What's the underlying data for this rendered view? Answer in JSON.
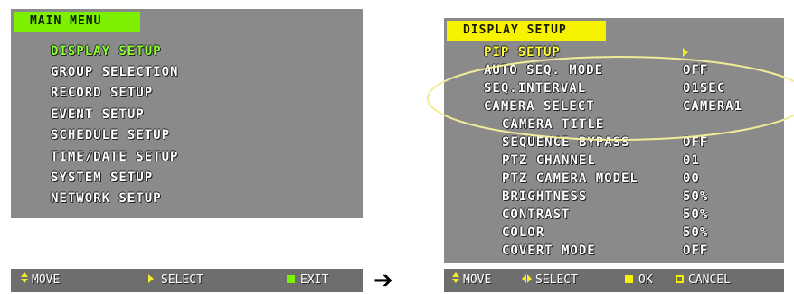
{
  "main_menu": {
    "title": "MAIN MENU",
    "items": [
      "DISPLAY SETUP",
      "GROUP SELECTION",
      "RECORD SETUP",
      "EVENT SETUP",
      "SCHEDULE SETUP",
      "TIME/DATE SETUP",
      "SYSTEM SETUP",
      "NETWORK SETUP"
    ],
    "footer": {
      "move": "MOVE",
      "select": "SELECT",
      "exit": "EXIT"
    }
  },
  "arrow": "➔",
  "display_setup": {
    "title": "DISPLAY SETUP",
    "rows": [
      {
        "label": "PIP SETUP",
        "value": ""
      },
      {
        "label": "AUTO SEQ. MODE",
        "value": "OFF"
      },
      {
        "label": "SEQ.INTERVAL",
        "value": "01SEC"
      },
      {
        "label": "CAMERA SELECT",
        "value": "CAMERA1"
      },
      {
        "label": "CAMERA TITLE",
        "value": ""
      },
      {
        "label": "SEQUENCE BYPASS",
        "value": "OFF"
      },
      {
        "label": "PTZ CHANNEL",
        "value": "01"
      },
      {
        "label": "PTZ CAMERA MODEL",
        "value": "00"
      },
      {
        "label": "BRIGHTNESS",
        "value": "50%"
      },
      {
        "label": "CONTRAST",
        "value": "50%"
      },
      {
        "label": "COLOR",
        "value": "50%"
      },
      {
        "label": "COVERT MODE",
        "value": "OFF"
      }
    ],
    "footer": {
      "move": "MOVE",
      "select": "SELECT",
      "ok": "OK",
      "cancel": "CANCEL"
    }
  },
  "colors": {
    "screen_bg": "#8a8a8a",
    "title_green": "#7cf000",
    "title_yellow": "#f7f200",
    "highlight_ellipse": "#f0ec9a"
  }
}
